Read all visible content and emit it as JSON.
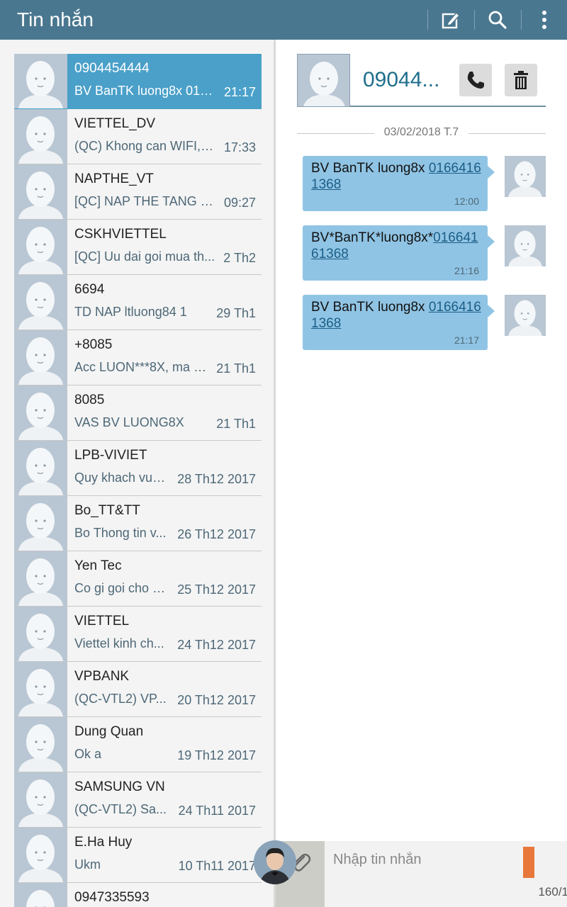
{
  "app": {
    "title": "Tin nhắn",
    "actions": [
      "compose-icon",
      "search-icon",
      "more-icon"
    ],
    "colors": {
      "action_bar": "#4a7790",
      "selected_row": "#4aa0c9",
      "bubble": "#90c4e4",
      "accent": "#1f6e8c"
    }
  },
  "conversations": [
    {
      "name": "0904454444",
      "preview": "BV BanTK luong8x 016...",
      "time": "21:17",
      "selected": true
    },
    {
      "name": "VIETTEL_DV",
      "preview": "(QC) Khong can WIFI, k...",
      "time": "17:33"
    },
    {
      "name": "NAPTHE_VT",
      "preview": "[QC] NAP THE TANG d...",
      "time": "09:27"
    },
    {
      "name": "CSKHVIETTEL",
      "preview": "[QC] Uu dai goi mua th...",
      "time": "2 Th2"
    },
    {
      "name": "6694",
      "preview": "TD NAP ltluong84 1",
      "time": "29 Th1"
    },
    {
      "name": "+8085",
      "preview": "Acc LUON***8X, ma c...",
      "time": "21 Th1"
    },
    {
      "name": "8085",
      "preview": "VAS BV LUONG8X",
      "time": "21 Th1"
    },
    {
      "name": "LPB-VIVIET",
      "preview": "Quy khach vua...",
      "time": "28 Th12 2017"
    },
    {
      "name": "Bo_TT&TT",
      "preview": "Bo Thong tin v...",
      "time": "26 Th12 2017"
    },
    {
      "name": "Yen Tec",
      "preview": "Co gi goi cho a...",
      "time": "25 Th12 2017"
    },
    {
      "name": "VIETTEL",
      "preview": "Viettel kinh ch...",
      "time": "24 Th12 2017"
    },
    {
      "name": "VPBANK",
      "preview": "(QC-VTL2) VP...",
      "time": "20 Th12 2017"
    },
    {
      "name": "Dung Quan",
      "preview": "Ok a",
      "time": "19 Th12 2017"
    },
    {
      "name": "SAMSUNG VN",
      "preview": "(QC-VTL2) Sa...",
      "time": "24 Th11 2017"
    },
    {
      "name": "E.Ha Huy",
      "preview": "Ukm",
      "time": "10 Th11 2017"
    },
    {
      "name": "0947335593",
      "preview": "",
      "time": ""
    }
  ],
  "thread": {
    "contact": "09044...",
    "actions": [
      "phone-icon",
      "trash-icon"
    ],
    "date": "03/02/2018 T.7",
    "messages": [
      {
        "text": "BV BanTK luong8x ",
        "link": "01664161368",
        "time": "12:00"
      },
      {
        "text": "BV*BanTK*luong8x*",
        "link": "01664161368",
        "time": "21:16"
      },
      {
        "text": "BV BanTK luong8x ",
        "link": "01664161368",
        "time": "21:17"
      }
    ]
  },
  "compose": {
    "placeholder": "Nhập tin nhắn",
    "counter": "160/1"
  }
}
